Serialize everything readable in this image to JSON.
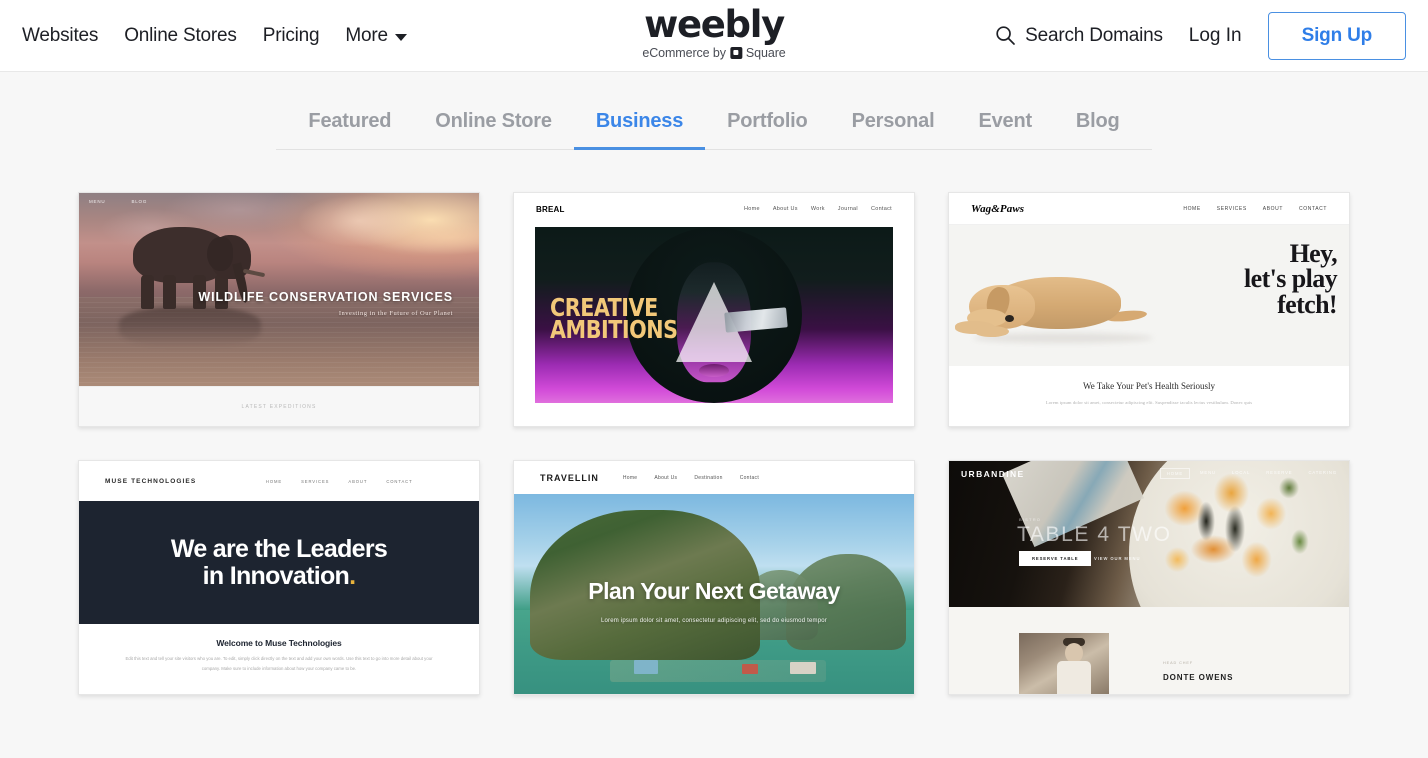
{
  "header": {
    "nav": [
      {
        "label": "Websites"
      },
      {
        "label": "Online Stores"
      },
      {
        "label": "Pricing"
      },
      {
        "label": "More"
      }
    ],
    "logo": {
      "name": "weebly",
      "tagline_pre": "eCommerce by",
      "tagline_post": "Square",
      "square_icon": "square-logo-icon"
    },
    "search_label": "Search Domains",
    "search_icon": "search-icon",
    "login_label": "Log In",
    "signup_label": "Sign Up",
    "caret_icon": "chevron-down-icon",
    "accent_color": "#3b86e8",
    "text_color": "#1d1f25"
  },
  "tabs": {
    "active": "Business",
    "items": [
      {
        "label": "Featured"
      },
      {
        "label": "Online Store"
      },
      {
        "label": "Business"
      },
      {
        "label": "Portfolio"
      },
      {
        "label": "Personal"
      },
      {
        "label": "Event"
      },
      {
        "label": "Blog"
      }
    ]
  },
  "templates": [
    {
      "id": "wildlife-conservation",
      "brand": "MENU",
      "brand_right": "BLOG",
      "title": "WILDLIFE CONSERVATION SERVICES",
      "subtitle": "Investing in the Future of Our Planet",
      "footer": "LATEST EXPEDITIONS"
    },
    {
      "id": "breal",
      "brand": "BREAL",
      "nav": [
        "Home",
        "About Us",
        "Work",
        "Journal",
        "Contact"
      ],
      "title_line1": "CREATIVE",
      "title_line2": "AMBITIONS"
    },
    {
      "id": "wag-and-paws",
      "brand": "Wag&Paws",
      "nav": [
        "HOME",
        "SERVICES",
        "ABOUT",
        "CONTACT"
      ],
      "title_line1": "Hey,",
      "title_line2": "let's play",
      "title_line3": "fetch!",
      "footer_heading": "We Take Your Pet's Health Seriously",
      "footer_text": "Lorem ipsum dolor sit amet, consectetur adipiscing elit. Suspendisse iaculis lectus vestibulum. Donec quis"
    },
    {
      "id": "muse-technologies",
      "brand": "MUSE TECHNOLOGIES",
      "nav": [
        "HOME",
        "SERVICES",
        "ABOUT",
        "CONTACT"
      ],
      "title_line1": "We are the Leaders",
      "title_line2": "in Innovation",
      "title_dot": ".",
      "footer_heading": "Welcome to Muse Technologies",
      "footer_text": "Edit this text and tell your site visitors who you are. To edit, simply click directly on the text and add your own words. Use this text to go into more detail about your company. Make sure to include information about how your company came to be."
    },
    {
      "id": "travellin",
      "brand": "TRAVELLIN",
      "nav": [
        "Home",
        "About Us",
        "Destination",
        "Contact"
      ],
      "title": "Plan Your Next Getaway",
      "subtitle": "Lorem ipsum dolor sit amet, consectetur adipiscing elit, sed do eiusmod tempor"
    },
    {
      "id": "urbandine",
      "brand": "URBANDINE",
      "nav": [
        "HOME",
        "MENU",
        "LOCAL",
        "RESERVE",
        "CATERING"
      ],
      "eyebrow": "BISTRO",
      "title": "TABLE 4 TWO",
      "button_primary": "RESERVE TABLE",
      "button_secondary": "VIEW OUR MENU",
      "chef_eyebrow": "HEAD CHEF",
      "chef_name": "DONTE OWENS"
    }
  ]
}
